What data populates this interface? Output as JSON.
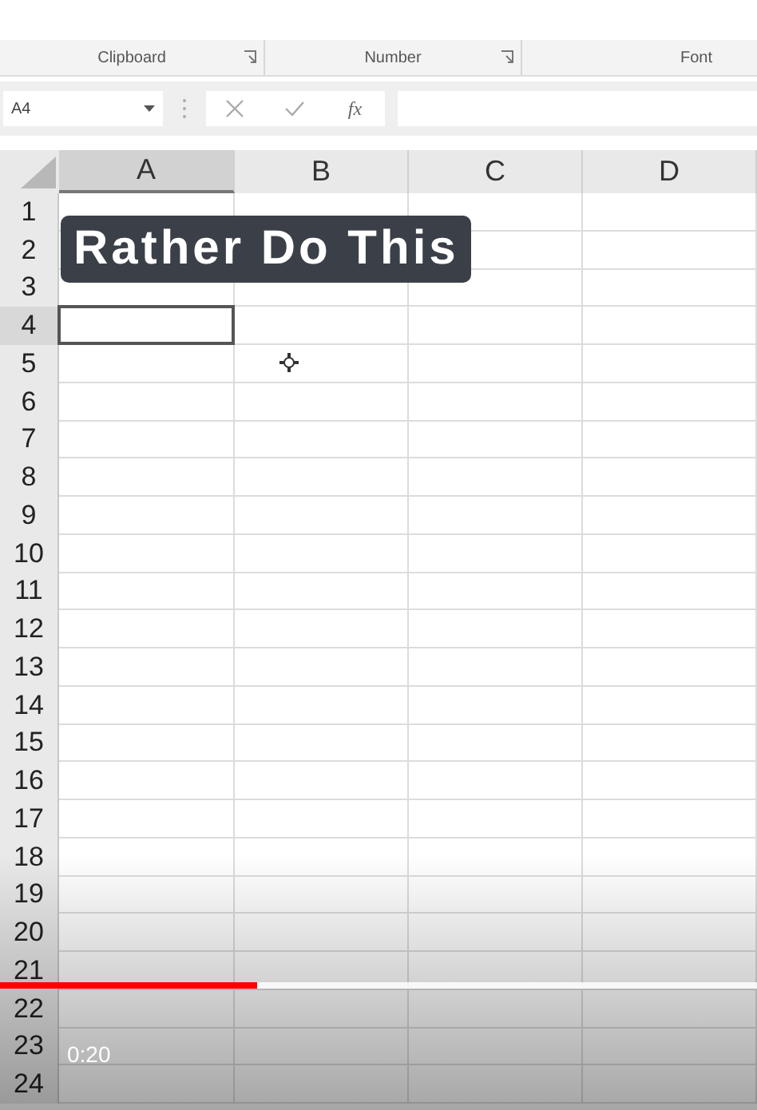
{
  "ribbon_groups": [
    {
      "label": "Clipboard",
      "launcher": true
    },
    {
      "label": "Number",
      "launcher": true
    },
    {
      "label": "Font",
      "launcher": false
    }
  ],
  "name_box": {
    "value": "A4"
  },
  "formula_bar": {
    "function_label": "fx"
  },
  "columns": [
    {
      "label": "A",
      "selected": true
    },
    {
      "label": "B",
      "selected": false
    },
    {
      "label": "C",
      "selected": false
    },
    {
      "label": "D",
      "selected": false
    }
  ],
  "rows": [
    {
      "label": "1",
      "selected": false
    },
    {
      "label": "2",
      "selected": false
    },
    {
      "label": "3",
      "selected": false
    },
    {
      "label": "4",
      "selected": true
    },
    {
      "label": "5",
      "selected": false
    },
    {
      "label": "6",
      "selected": false
    },
    {
      "label": "7",
      "selected": false
    },
    {
      "label": "8",
      "selected": false
    },
    {
      "label": "9",
      "selected": false
    },
    {
      "label": "10",
      "selected": false
    },
    {
      "label": "11",
      "selected": false
    },
    {
      "label": "12",
      "selected": false
    },
    {
      "label": "13",
      "selected": false
    },
    {
      "label": "14",
      "selected": false
    },
    {
      "label": "15",
      "selected": false
    },
    {
      "label": "16",
      "selected": false
    },
    {
      "label": "17",
      "selected": false
    },
    {
      "label": "18",
      "selected": false
    },
    {
      "label": "19",
      "selected": false
    },
    {
      "label": "20",
      "selected": false
    },
    {
      "label": "21",
      "selected": false
    },
    {
      "label": "22",
      "selected": false
    },
    {
      "label": "23",
      "selected": false
    },
    {
      "label": "24",
      "selected": false
    }
  ],
  "caption": "Rather Do This",
  "player": {
    "level": 0.34,
    "time": "0:20"
  }
}
